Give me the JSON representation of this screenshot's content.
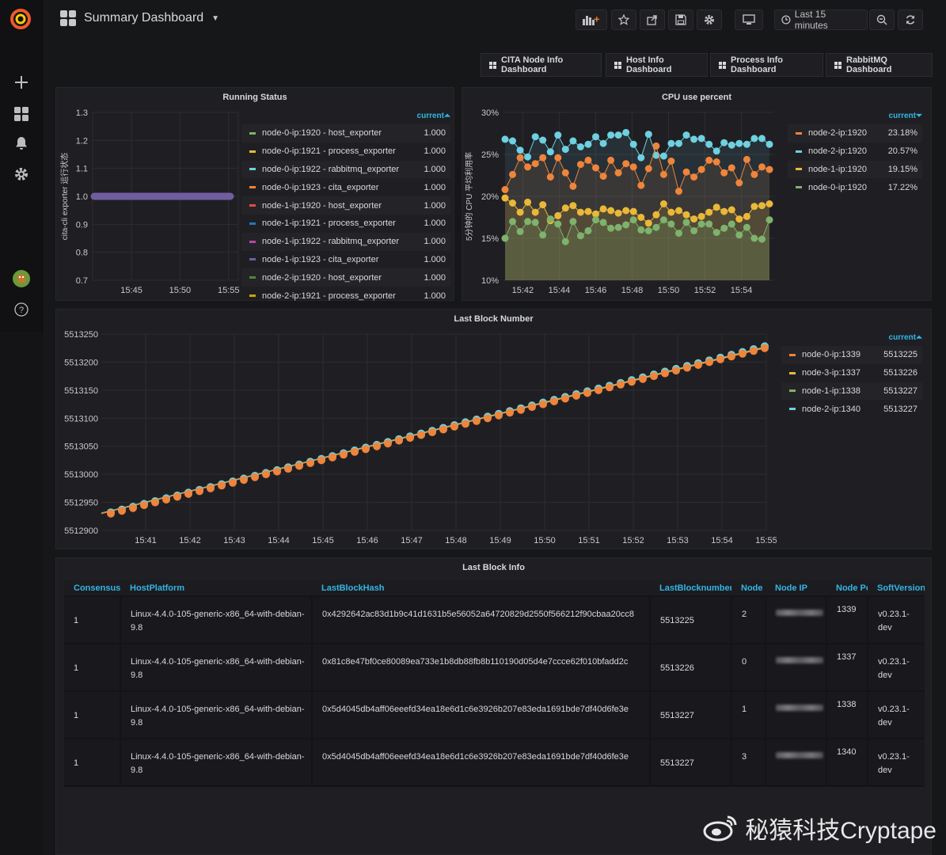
{
  "header": {
    "title": "Summary Dashboard",
    "time_range": "Last 15 minutes"
  },
  "links": [
    {
      "label": "CITA Node Info Dashboard"
    },
    {
      "label": "Host Info Dashboard"
    },
    {
      "label": "Process Info Dashboard"
    },
    {
      "label": "RabbitMQ Dashboard"
    }
  ],
  "running_status": {
    "title": "Running Status",
    "ylabel": "cita-cli exporter 运行状态",
    "legend_header": "current",
    "yticks": [
      "1.3",
      "1.2",
      "1.1",
      "1.0",
      "0.9",
      "0.8",
      "0.7"
    ],
    "xticks": [
      "15:45",
      "15:50",
      "15:55"
    ],
    "legend": [
      {
        "name": "node-0-ip:1920 - host_exporter",
        "value": "1.000",
        "color": "#7eb26d"
      },
      {
        "name": "node-0-ip:1921 - process_exporter",
        "value": "1.000",
        "color": "#eab839"
      },
      {
        "name": "node-0-ip:1922 - rabbitmq_exporter",
        "value": "1.000",
        "color": "#6ed0e0"
      },
      {
        "name": "node-0-ip:1923 - cita_exporter",
        "value": "1.000",
        "color": "#ef843c"
      },
      {
        "name": "node-1-ip:1920 - host_exporter",
        "value": "1.000",
        "color": "#e24d42"
      },
      {
        "name": "node-1-ip:1921 - process_exporter",
        "value": "1.000",
        "color": "#1f78c1"
      },
      {
        "name": "node-1-ip:1922 - rabbitmq_exporter",
        "value": "1.000",
        "color": "#ba43a9"
      },
      {
        "name": "node-1-ip:1923 - cita_exporter",
        "value": "1.000",
        "color": "#705da0"
      },
      {
        "name": "node-2-ip:1920 - host_exporter",
        "value": "1.000",
        "color": "#508642"
      },
      {
        "name": "node-2-ip:1921 - process_exporter",
        "value": "1.000",
        "color": "#cca300"
      }
    ]
  },
  "cpu": {
    "title": "CPU use percent",
    "ylabel": "5分钟的 CPU 平均利用率",
    "legend_header": "current",
    "yticks": [
      "30%",
      "25%",
      "20%",
      "15%",
      "10%"
    ],
    "xticks": [
      "15:42",
      "15:44",
      "15:46",
      "15:48",
      "15:50",
      "15:52",
      "15:54"
    ],
    "legend": [
      {
        "name": "node-2-ip:1920",
        "value": "23.18%",
        "color": "#ef843c"
      },
      {
        "name": "node-2-ip:1920",
        "value": "20.57%",
        "color": "#6ed0e0"
      },
      {
        "name": "node-1-ip:1920",
        "value": "19.15%",
        "color": "#eab839"
      },
      {
        "name": "node-0-ip:1920",
        "value": "17.22%",
        "color": "#7eb26d"
      }
    ]
  },
  "block_number": {
    "title": "Last Block Number",
    "legend_header": "current",
    "yticks": [
      "5513250",
      "5513200",
      "5513150",
      "5513100",
      "5513050",
      "5513000",
      "5512950",
      "5512900"
    ],
    "xticks": [
      "15:41",
      "15:42",
      "15:43",
      "15:44",
      "15:45",
      "15:46",
      "15:47",
      "15:48",
      "15:49",
      "15:50",
      "15:51",
      "15:52",
      "15:53",
      "15:54",
      "15:55"
    ],
    "legend": [
      {
        "name": "node-0-ip:1339",
        "value": "5513225",
        "color": "#ef843c"
      },
      {
        "name": "node-3-ip:1337",
        "value": "5513226",
        "color": "#eab839"
      },
      {
        "name": "node-1-ip:1338",
        "value": "5513227",
        "color": "#7eb26d"
      },
      {
        "name": "node-2-ip:1340",
        "value": "5513227",
        "color": "#6ed0e0"
      }
    ]
  },
  "block_info": {
    "title": "Last Block Info",
    "columns": [
      "Consensus",
      "HostPlatform",
      "LastBlockHash",
      "LastBlocknumber",
      "Node ID",
      "Node IP",
      "Node Port",
      "SoftVersion"
    ],
    "rows": [
      {
        "consensus": "1",
        "platform": "Linux-4.4.0-105-generic-x86_64-with-debian-9.8",
        "hash": "0x4292642ac83d1b9c41d1631b5e56052a64720829d2550f566212f90cbaa20cc8",
        "number": "5513225",
        "node_id": "2",
        "port": "1339",
        "version": "v0.23.1-dev"
      },
      {
        "consensus": "1",
        "platform": "Linux-4.4.0-105-generic-x86_64-with-debian-9.8",
        "hash": "0x81c8e47bf0ce80089ea733e1b8db88fb8b110190d05d4e7ccce62f010bfadd2c",
        "number": "5513226",
        "node_id": "0",
        "port": "1337",
        "version": "v0.23.1-dev"
      },
      {
        "consensus": "1",
        "platform": "Linux-4.4.0-105-generic-x86_64-with-debian-9.8",
        "hash": "0x5d4045db4aff06eeefd34ea18e6d1c6e3926b207e83eda1691bde7df40d6fe3e",
        "number": "5513227",
        "node_id": "1",
        "port": "1338",
        "version": "v0.23.1-dev"
      },
      {
        "consensus": "1",
        "platform": "Linux-4.4.0-105-generic-x86_64-with-debian-9.8",
        "hash": "0x5d4045db4aff06eeefd34ea18e6d1c6e3926b207e83eda1691bde7df40d6fe3e",
        "number": "5513227",
        "node_id": "3",
        "port": "1340",
        "version": "v0.23.1-dev"
      }
    ]
  },
  "watermark": {
    "text": "秘猿科技Cryptape"
  },
  "chart_data": [
    {
      "type": "line",
      "title": "Running Status",
      "ylabel": "cita-cli exporter 运行状态",
      "ylim": [
        0.7,
        1.3
      ],
      "x": [
        "15:41",
        "15:55"
      ],
      "series": [
        {
          "name": "node-0-ip:1920 - host_exporter",
          "values": [
            1.0,
            1.0
          ]
        },
        {
          "name": "node-1-ip:1923 - cita_exporter",
          "values": [
            1.0,
            1.0
          ]
        }
      ]
    },
    {
      "type": "line",
      "title": "CPU use percent",
      "ylabel": "5分钟的 CPU 平均利用率",
      "ylim": [
        10,
        30
      ],
      "x": [
        "15:41",
        "15:55"
      ],
      "series": [
        {
          "name": "node-2-ip:1920",
          "values": [
            26.8,
            26.6,
            25.5,
            24.7,
            27.1,
            26.7,
            25.3,
            27.3,
            25.6,
            26.6,
            25.9,
            26.2,
            27.1,
            26.3,
            27.3,
            27.3,
            27.6,
            26.2,
            24.6,
            27.4,
            24.9,
            24.8,
            26.3,
            26.3,
            27.3,
            26.8,
            26.9,
            26.2,
            25.4,
            26.4,
            26.1,
            26.3,
            26.2,
            26.9,
            26.9,
            26.2
          ]
        },
        {
          "name": "node-2-ip:1920",
          "values": [
            20.8,
            22.6,
            24.6,
            23.5,
            23.9,
            24.6,
            22.3,
            24.6,
            22.8,
            21.2,
            23.8,
            24.3,
            23.4,
            22.4,
            24.3,
            22.8,
            23.9,
            23.5,
            21.3,
            23.3,
            26.0,
            22.6,
            24.2,
            20.6,
            22.9,
            22.3,
            23.2,
            24.3,
            24.1,
            22.8,
            23.4,
            21.6,
            24.4,
            22.6,
            23.5,
            23.2
          ]
        },
        {
          "name": "node-1-ip:1920",
          "values": [
            19.8,
            19.2,
            18.1,
            19.3,
            18.1,
            19.0,
            17.1,
            17.7,
            18.6,
            18.9,
            18.1,
            18.2,
            17.9,
            18.5,
            18.3,
            18.0,
            18.3,
            18.2,
            17.5,
            16.8,
            17.8,
            19.1,
            18.1,
            18.3,
            17.8,
            17.3,
            17.6,
            18.1,
            18.7,
            18.2,
            18.4,
            17.3,
            17.6,
            18.8,
            18.9,
            19.1
          ]
        },
        {
          "name": "node-0-ip:1920",
          "values": [
            15.0,
            17.0,
            15.8,
            17.0,
            16.9,
            15.4,
            17.3,
            16.7,
            14.6,
            17.0,
            15.3,
            15.9,
            17.2,
            16.9,
            16.2,
            16.3,
            16.6,
            17.2,
            16.0,
            15.9,
            16.3,
            17.2,
            16.7,
            15.6,
            16.9,
            15.9,
            16.7,
            16.7,
            15.7,
            16.2,
            16.7,
            15.4,
            16.3,
            15.0,
            14.9,
            17.2
          ]
        }
      ]
    },
    {
      "type": "line",
      "title": "Last Block Number",
      "ylim": [
        5512900,
        5513250
      ],
      "x": [
        "15:40",
        "15:55"
      ],
      "series": [
        {
          "name": "node-0-ip:1339",
          "values": [
            5512930,
            5513225
          ]
        },
        {
          "name": "node-3-ip:1337",
          "values": [
            5512930,
            5513226
          ]
        },
        {
          "name": "node-1-ip:1338",
          "values": [
            5512931,
            5513227
          ]
        },
        {
          "name": "node-2-ip:1340",
          "values": [
            5512931,
            5513227
          ]
        }
      ]
    }
  ]
}
